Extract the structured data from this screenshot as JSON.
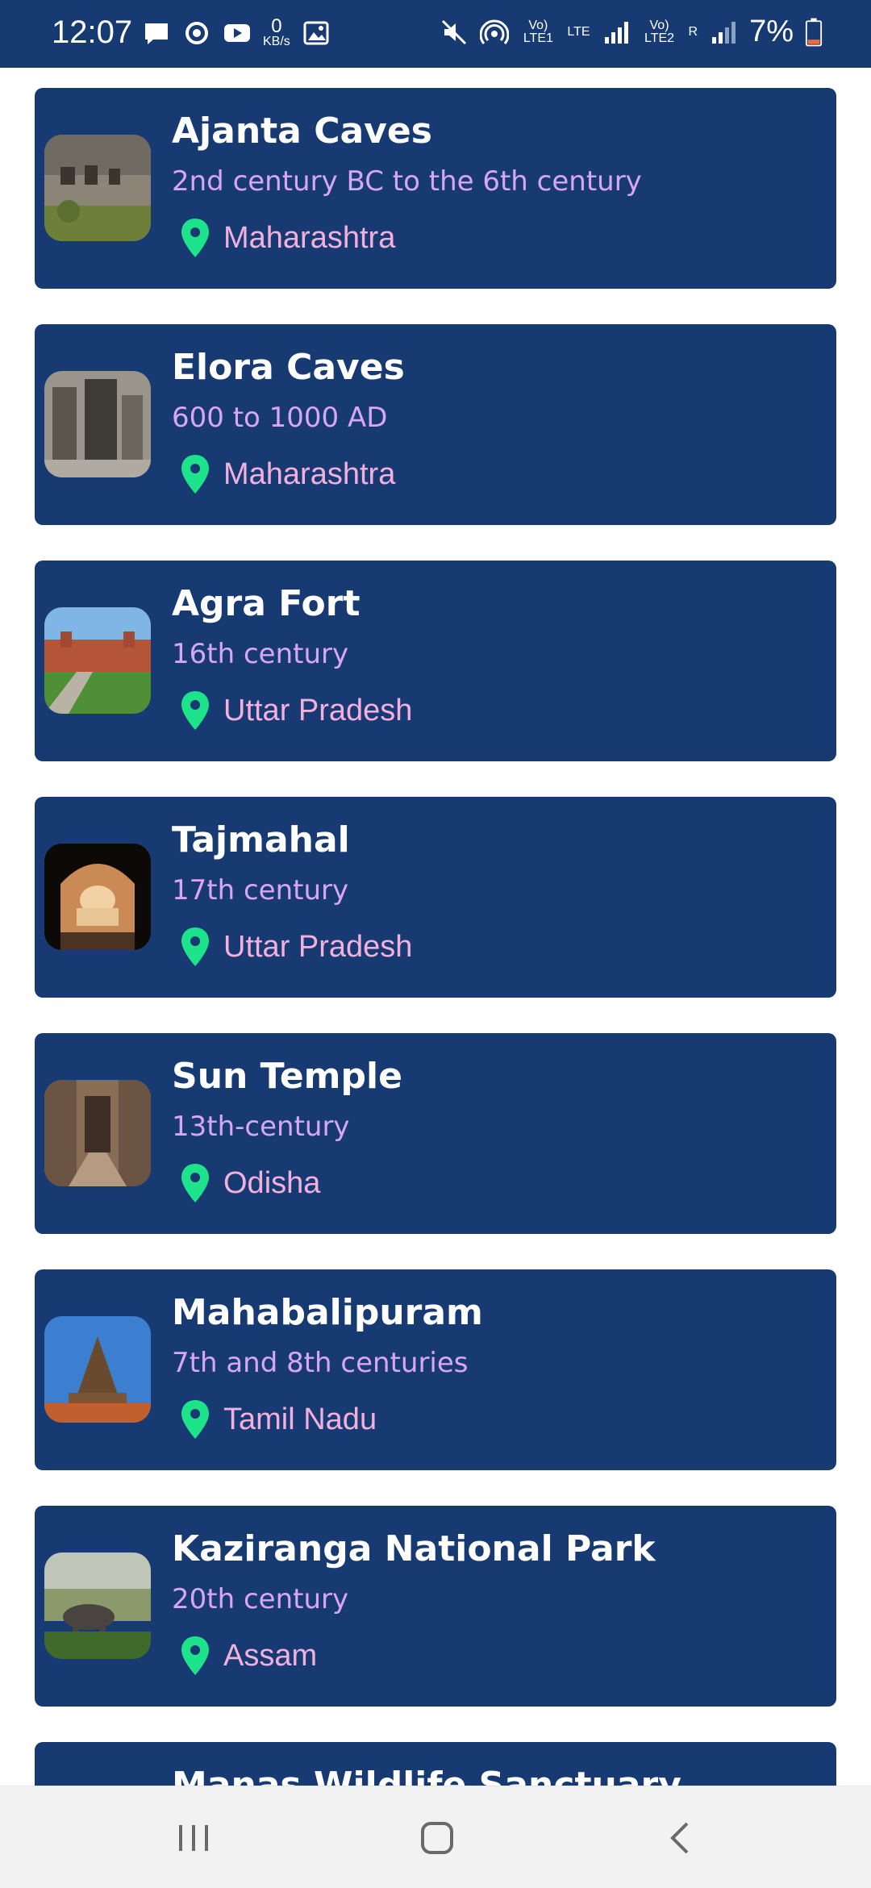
{
  "status_bar": {
    "time": "12:07",
    "network_speed_value": "0",
    "network_speed_unit": "KB/s",
    "sim1_label": "Vo) LTE1",
    "sim1_tech": "LTE",
    "sim2_label": "Vo) LTE2",
    "sim2_roaming": "R",
    "battery_text": "7%",
    "icons": [
      "message-icon",
      "sync-icon",
      "youtube-icon",
      "gallery-icon",
      "mute-icon",
      "hotspot-icon",
      "signal-icon",
      "battery-icon"
    ]
  },
  "places": [
    {
      "title": "Ajanta Caves",
      "era": "2nd century BC to the 6th century",
      "location": "Maharashtra"
    },
    {
      "title": "Elora Caves",
      "era": "600 to 1000 AD",
      "location": "Maharashtra"
    },
    {
      "title": "Agra Fort",
      "era": "16th century",
      "location": "Uttar Pradesh"
    },
    {
      "title": "Tajmahal",
      "era": "17th century",
      "location": "Uttar Pradesh"
    },
    {
      "title": "Sun Temple",
      "era": "13th-century",
      "location": "Odisha"
    },
    {
      "title": "Mahabalipuram",
      "era": "7th and 8th centuries",
      "location": "Tamil Nadu"
    },
    {
      "title": "Kaziranga National Park",
      "era": "20th century",
      "location": "Assam"
    },
    {
      "title": "Manas Wildlife Sanctuary",
      "era": "",
      "location": ""
    }
  ],
  "colors": {
    "card_background": "#173a72",
    "title": "#ffffff",
    "era": "#d7a6f5",
    "location": "#f2b0dd",
    "pin": "#1de38a",
    "nav_background": "#f2f2f2"
  },
  "nav_bar": {
    "buttons": [
      "recent-apps-icon",
      "home-icon",
      "back-icon"
    ]
  }
}
